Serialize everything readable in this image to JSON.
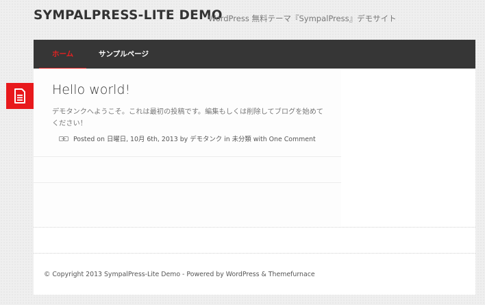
{
  "header": {
    "site_title": "SYMPALPRESS-LITE DEMO",
    "site_description": "WordPress 無料テーマ『SympalPress』デモサイト"
  },
  "nav": {
    "items": [
      {
        "label": "ホーム",
        "active": true
      },
      {
        "label": "サンプルページ",
        "active": false
      }
    ]
  },
  "post": {
    "icon": "document-icon",
    "title": "Hello world!",
    "excerpt": "デモタンクへようこそ。これは最初の投稿です。編集もしくは削除してブログを始めてください！",
    "meta": {
      "icon": "link-icon",
      "posted_on": "Posted on",
      "date": "日曜日, 10月 6th, 2013",
      "by": "by",
      "author": "デモタンク",
      "in": "in",
      "category": "未分類",
      "with": "with",
      "comments": "One Comment"
    }
  },
  "footer": {
    "copyright": "© Copyright 2013 SympalPress-Lite Demo - Powered by WordPress & Themefurnace"
  },
  "colors": {
    "accent": "#e8191c",
    "navbar": "#363636"
  }
}
